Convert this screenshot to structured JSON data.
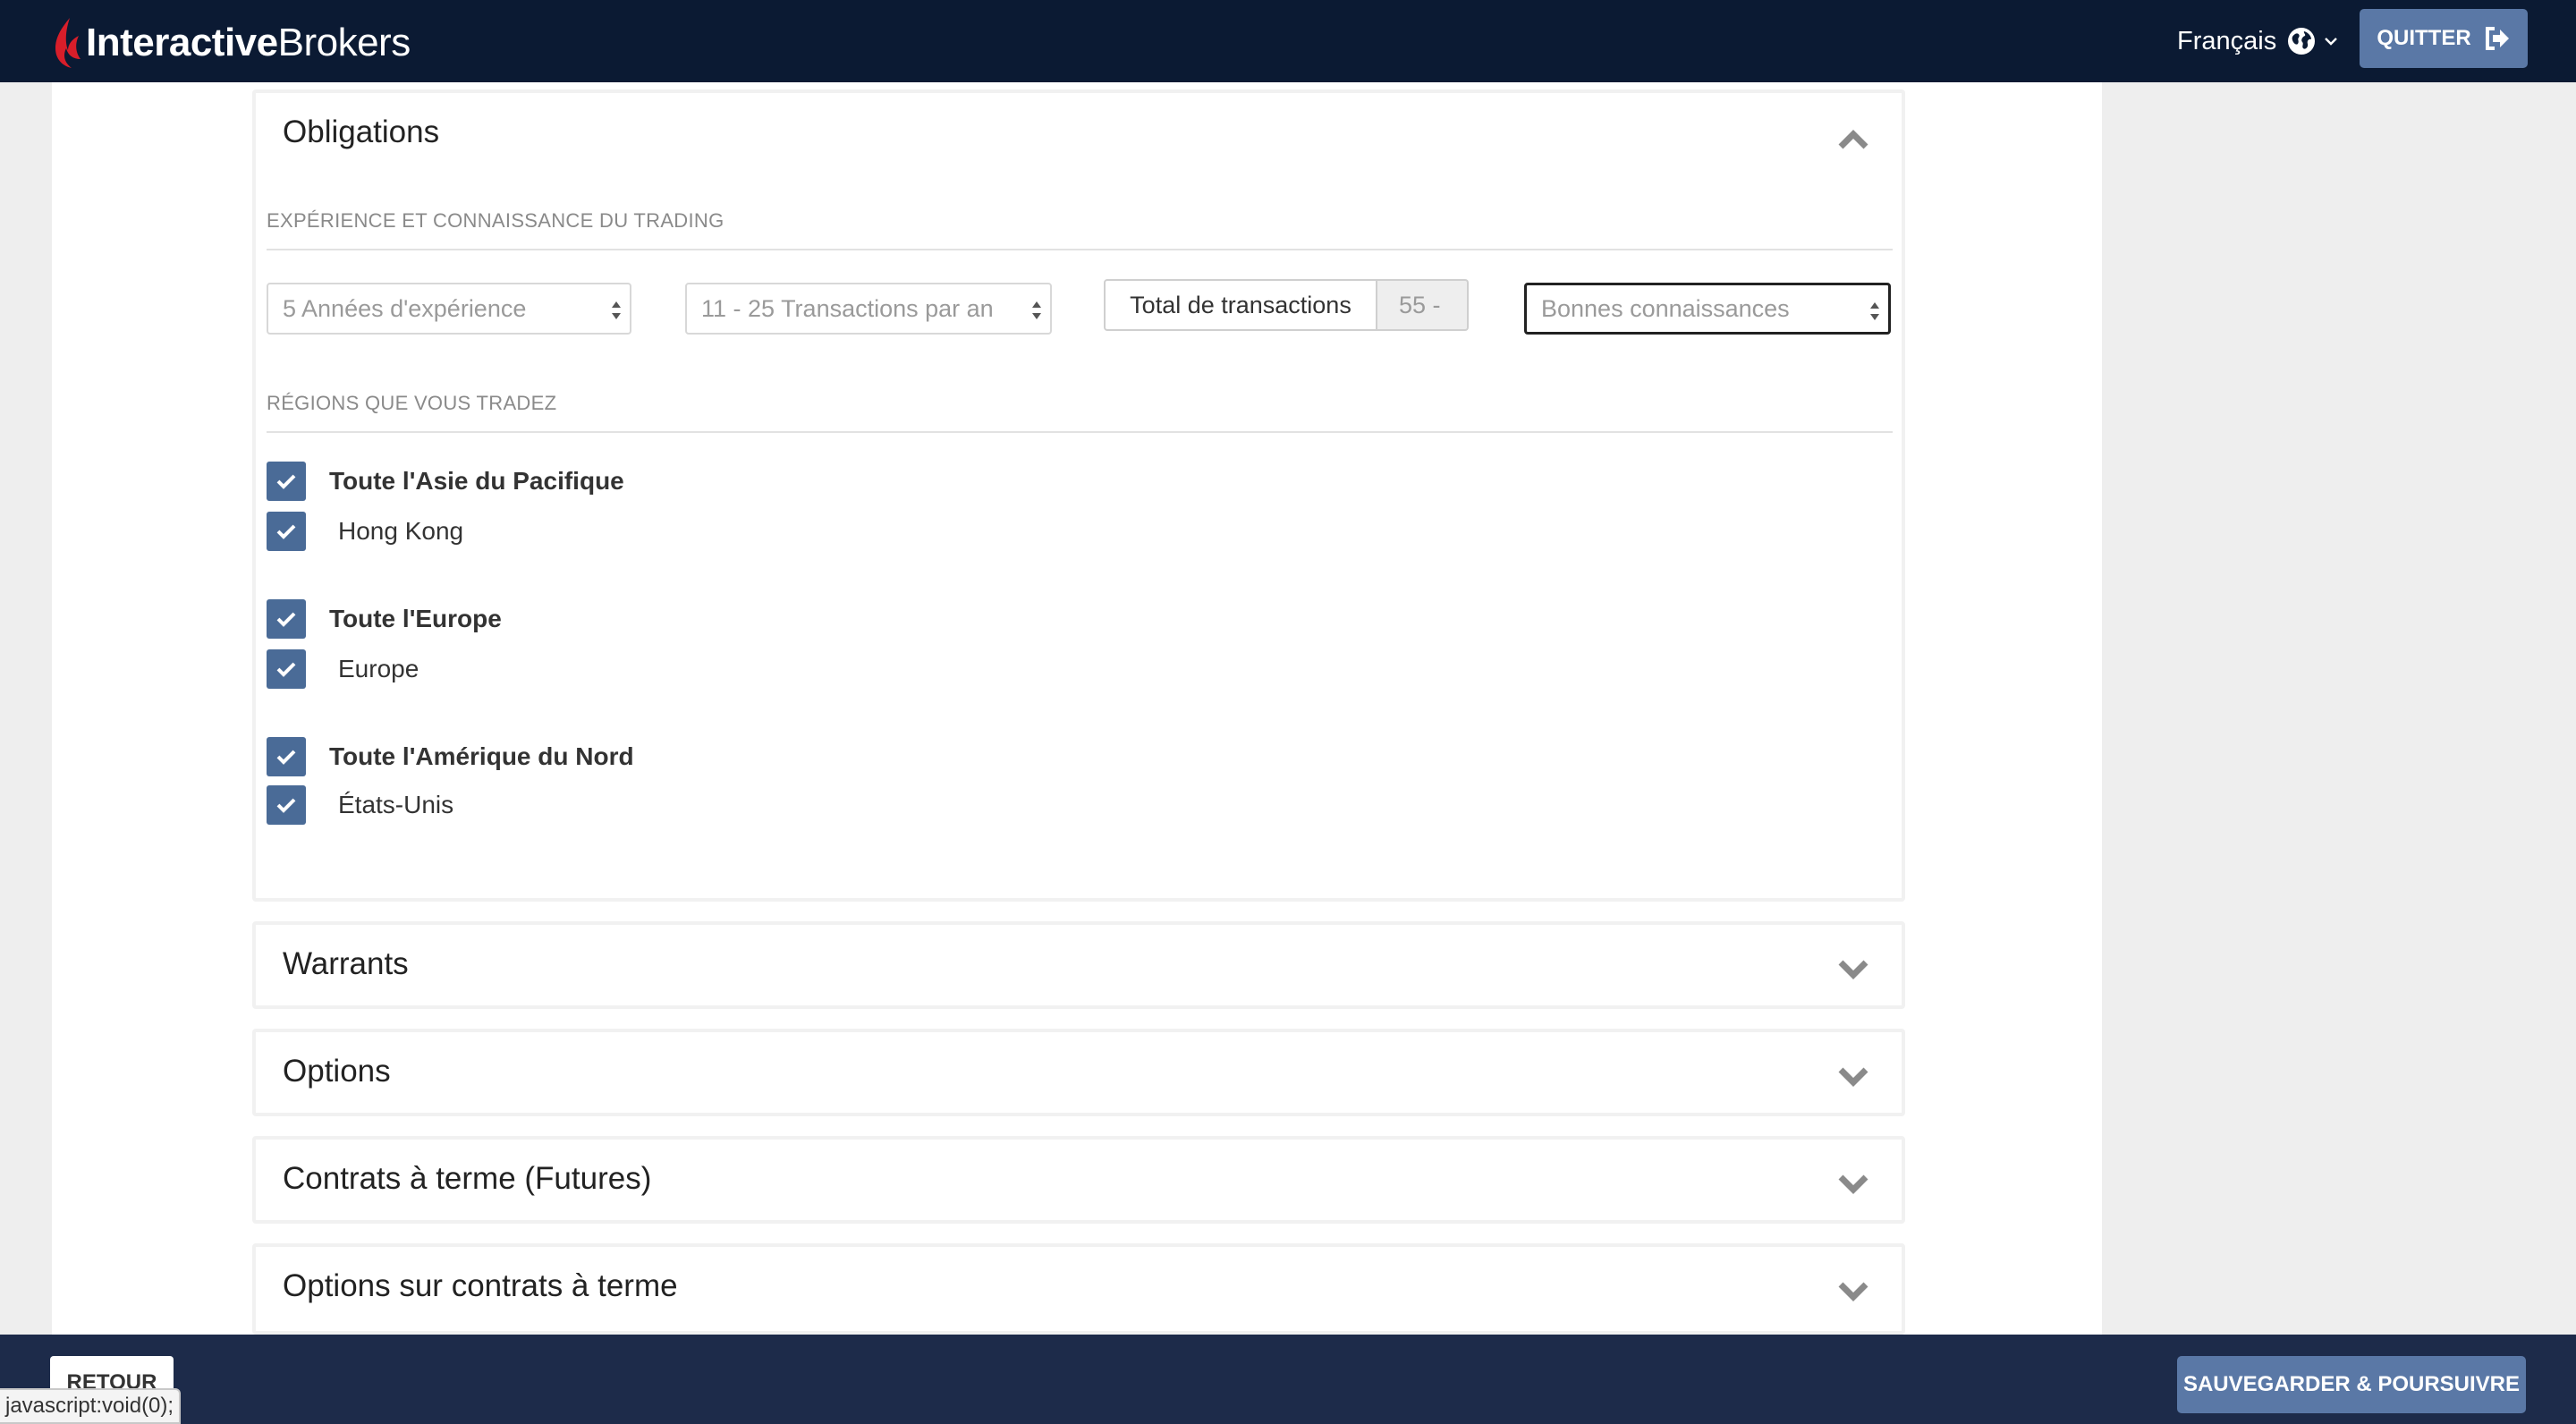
{
  "header": {
    "logo_bold": "Interactive",
    "logo_regular": "Brokers",
    "language": "Français",
    "quit_label": "QUITTER"
  },
  "bonds": {
    "title": "Obligations",
    "experience_section": "EXPÉRIENCE ET CONNAISSANCE DU TRADING",
    "years_select": "5 Années d'expérience",
    "trades_select": "11 - 25 Transactions par an",
    "total_label": "Total de transactions",
    "total_value": "55 -",
    "knowledge_select": "Bonnes connaissances",
    "regions_section": "RÉGIONS QUE VOUS TRADEZ",
    "regions": [
      {
        "group": "Toute l'Asie du Pacifique",
        "item": "Hong Kong"
      },
      {
        "group": "Toute l'Europe",
        "item": "Europe"
      },
      {
        "group": "Toute l'Amérique du Nord",
        "item": "États-Unis"
      }
    ]
  },
  "collapsed_sections": [
    "Warrants",
    "Options",
    "Contrats à terme (Futures)",
    "Options sur contrats à terme"
  ],
  "footer": {
    "back_label": "RETOUR",
    "save_label": "SAUVEGARDER & POURSUIVRE",
    "status_url": "javascript:void(0);"
  },
  "colors": {
    "header_bg": "#0b1a33",
    "footer_bg": "#1d2b4a",
    "accent": "#5a78a6",
    "checkbox": "#4a6b97"
  }
}
